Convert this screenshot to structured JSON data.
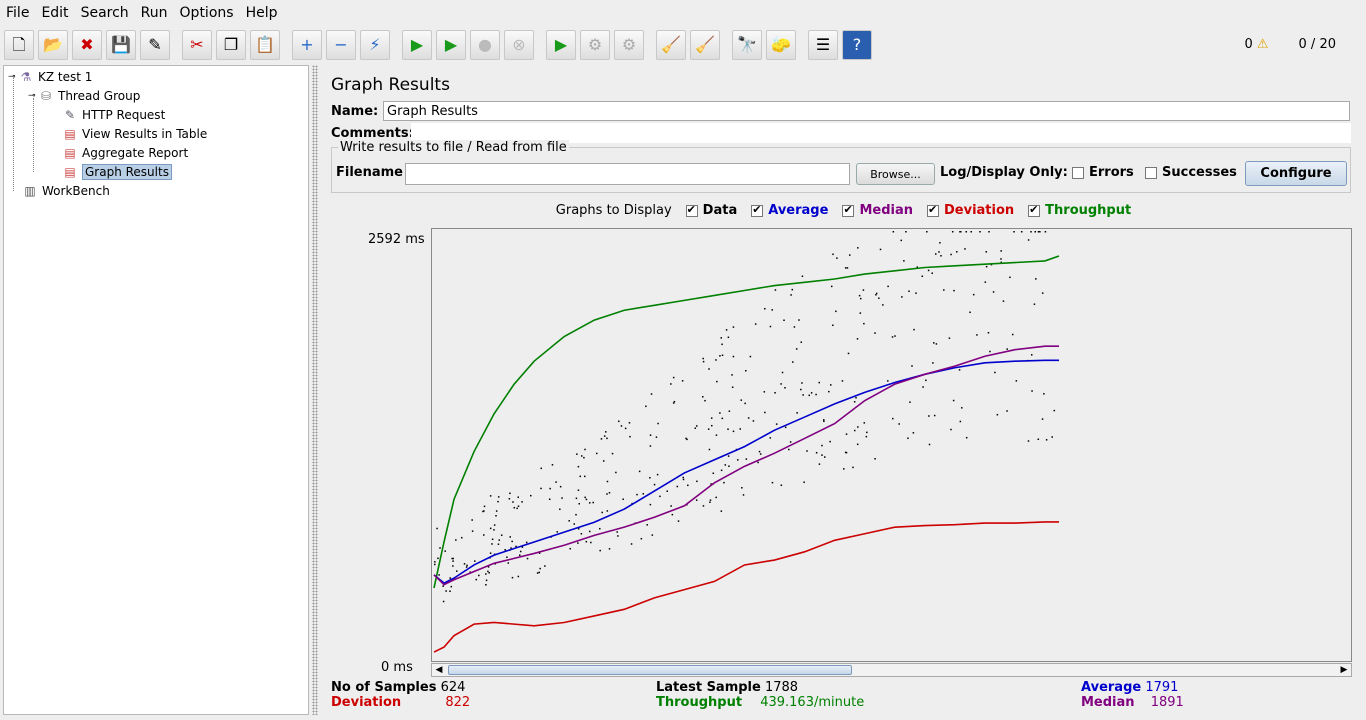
{
  "menu": [
    "File",
    "Edit",
    "Search",
    "Run",
    "Options",
    "Help"
  ],
  "toolbar": {
    "icons": [
      "new-icon",
      "open-icon",
      "close-icon",
      "save-icon",
      "save-as-icon",
      "cut-icon",
      "copy-icon",
      "paste-icon",
      "expand-icon",
      "collapse-icon",
      "toggle-icon",
      "start-icon",
      "start-no-pause-icon",
      "stop-icon",
      "shutdown-icon",
      "remote-start-icon",
      "remote-stop-icon",
      "remote-shutdown-icon",
      "clear-icon",
      "clear-all-icon",
      "search-icon",
      "reset-search-icon",
      "function-helper-icon",
      "help-icon"
    ],
    "warnings": "0",
    "threads": "0 / 20"
  },
  "tree": {
    "items": [
      "KZ test 1",
      "Thread Group",
      "HTTP Request",
      "View Results in Table",
      "Aggregate Report",
      "Graph Results",
      "WorkBench"
    ]
  },
  "panel": {
    "title": "Graph Results",
    "name_label": "Name:",
    "name_value": "Graph Results",
    "comments_label": "Comments:",
    "file_legend": "Write results to file / Read from file",
    "filename_label": "Filename",
    "browse": "Browse...",
    "log_display": "Log/Display Only:",
    "errors": "Errors",
    "successes": "Successes",
    "configure": "Configure",
    "graphs_label": "Graphs to Display",
    "checks": [
      "Data",
      "Average",
      "Median",
      "Deviation",
      "Throughput"
    ]
  },
  "colors": {
    "data": "#000000",
    "average": "#0000cc",
    "median": "#800080",
    "deviation": "#cc0000",
    "throughput": "#008000"
  },
  "chart_data": {
    "type": "line",
    "ymax_label": "2592 ms",
    "ymin_label": "0 ms",
    "ylim": [
      0,
      2592
    ],
    "x": [
      0,
      10,
      20,
      40,
      60,
      80,
      100,
      130,
      160,
      190,
      220,
      250,
      280,
      310,
      340,
      370,
      400,
      430,
      460,
      490,
      520,
      550,
      580,
      610,
      624
    ],
    "series": [
      {
        "name": "Throughput",
        "values": [
          420,
          700,
          960,
          1250,
          1480,
          1660,
          1800,
          1950,
          2050,
          2110,
          2140,
          2170,
          2200,
          2230,
          2260,
          2280,
          2300,
          2330,
          2350,
          2370,
          2380,
          2390,
          2400,
          2410,
          2440
        ]
      },
      {
        "name": "Average",
        "values": [
          500,
          450,
          480,
          560,
          620,
          660,
          700,
          760,
          820,
          900,
          1010,
          1120,
          1200,
          1280,
          1380,
          1460,
          1540,
          1610,
          1670,
          1720,
          1760,
          1790,
          1800,
          1805,
          1805
        ]
      },
      {
        "name": "Median",
        "values": [
          500,
          440,
          470,
          520,
          570,
          600,
          630,
          680,
          740,
          790,
          850,
          920,
          1060,
          1160,
          1240,
          1330,
          1420,
          1560,
          1660,
          1720,
          1770,
          1830,
          1870,
          1891,
          1891
        ]
      },
      {
        "name": "Deviation",
        "values": [
          30,
          60,
          130,
          200,
          210,
          200,
          190,
          210,
          250,
          290,
          360,
          410,
          460,
          560,
          590,
          640,
          710,
          750,
          790,
          800,
          805,
          815,
          815,
          822,
          822
        ]
      }
    ]
  },
  "stats": {
    "samples_label": "No of Samples",
    "samples": "624",
    "deviation_label": "Deviation",
    "deviation": "822",
    "latest_label": "Latest Sample",
    "latest": "1788",
    "throughput_label": "Throughput",
    "throughput": "439.163/minute",
    "average_label": "Average",
    "average": "1791",
    "median_label": "Median",
    "median": "1891"
  }
}
